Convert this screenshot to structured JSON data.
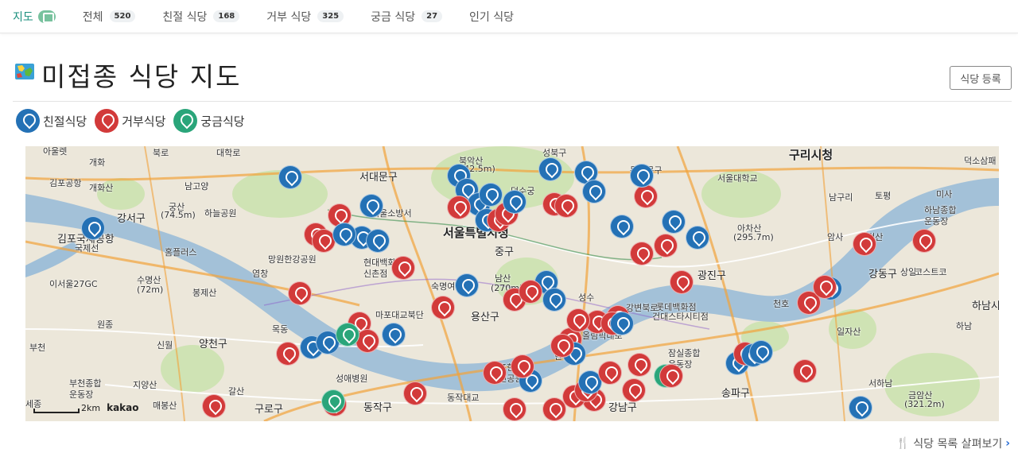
{
  "tabs": [
    {
      "label": "지도",
      "count": null,
      "active": true,
      "icon": "map-icon"
    },
    {
      "label": "전체",
      "count": "520"
    },
    {
      "label": "친절 식당",
      "count": "168"
    },
    {
      "label": "거부 식당",
      "count": "325"
    },
    {
      "label": "궁금 식당",
      "count": "27"
    },
    {
      "label": "인기 식당",
      "count": null
    }
  ],
  "page": {
    "title": "미접종 식당 지도",
    "title_icon": "world-map-icon",
    "register_label": "식당 등록"
  },
  "legend": [
    {
      "label": "친절식당",
      "color": "#2471b5"
    },
    {
      "label": "거부식당",
      "color": "#d23a3a"
    },
    {
      "label": "궁금식당",
      "color": "#2aa57a"
    }
  ],
  "map": {
    "labels": [
      {
        "text": "아울렛",
        "cls": ""
      },
      {
        "text": "개화",
        "cls": ""
      },
      {
        "text": "김포공항",
        "cls": ""
      },
      {
        "text": "개화산",
        "cls": ""
      },
      {
        "text": "강서구",
        "cls": "mid"
      },
      {
        "text": "궁산",
        "cls": ""
      },
      {
        "text": "(74.5m)",
        "cls": ""
      },
      {
        "text": "김포국제공항",
        "cls": "mid"
      },
      {
        "text": "국제선",
        "cls": ""
      },
      {
        "text": "홈플러스",
        "cls": ""
      },
      {
        "text": "이서울27GC",
        "cls": ""
      },
      {
        "text": "수명산",
        "cls": ""
      },
      {
        "text": "(72m)",
        "cls": ""
      },
      {
        "text": "봉제산",
        "cls": ""
      },
      {
        "text": "염창",
        "cls": ""
      },
      {
        "text": "망원한강공원",
        "cls": ""
      },
      {
        "text": "하늘공원",
        "cls": ""
      },
      {
        "text": "서대문구",
        "cls": "mid"
      },
      {
        "text": "서울소방서",
        "cls": ""
      },
      {
        "text": "현대백화점",
        "cls": ""
      },
      {
        "text": "신촌점",
        "cls": ""
      },
      {
        "text": "숙명여대",
        "cls": ""
      },
      {
        "text": "서울특별시청",
        "cls": "big"
      },
      {
        "text": "중구",
        "cls": "mid"
      },
      {
        "text": "남산",
        "cls": ""
      },
      {
        "text": "(270m)",
        "cls": ""
      },
      {
        "text": "용산구",
        "cls": "mid"
      },
      {
        "text": "마포대교북단",
        "cls": ""
      },
      {
        "text": "목동",
        "cls": ""
      },
      {
        "text": "양천구",
        "cls": "mid"
      },
      {
        "text": "신월",
        "cls": ""
      },
      {
        "text": "원종",
        "cls": ""
      },
      {
        "text": "부천",
        "cls": ""
      },
      {
        "text": "부천종합",
        "cls": ""
      },
      {
        "text": "운동장",
        "cls": ""
      },
      {
        "text": "지양산",
        "cls": ""
      },
      {
        "text": "매봉산",
        "cls": ""
      },
      {
        "text": "갈산",
        "cls": ""
      },
      {
        "text": "구로구",
        "cls": "mid"
      },
      {
        "text": "성애병원",
        "cls": ""
      },
      {
        "text": "동작구",
        "cls": "mid"
      },
      {
        "text": "동작대교",
        "cls": ""
      },
      {
        "text": "반포한강",
        "cls": ""
      },
      {
        "text": "시민공원",
        "cls": ""
      },
      {
        "text": "한남",
        "cls": ""
      },
      {
        "text": "성수",
        "cls": ""
      },
      {
        "text": "광진구",
        "cls": "mid"
      },
      {
        "text": "롯데백화점",
        "cls": ""
      },
      {
        "text": "건대스타시티점",
        "cls": ""
      },
      {
        "text": "강남구",
        "cls": "mid"
      },
      {
        "text": "잠실종합",
        "cls": ""
      },
      {
        "text": "운동장",
        "cls": ""
      },
      {
        "text": "송파구",
        "cls": "mid"
      },
      {
        "text": "석촌",
        "cls": ""
      },
      {
        "text": "천호",
        "cls": ""
      },
      {
        "text": "일자산",
        "cls": ""
      },
      {
        "text": "하남",
        "cls": ""
      },
      {
        "text": "강동구",
        "cls": "mid"
      },
      {
        "text": "상일",
        "cls": ""
      },
      {
        "text": "코스트코",
        "cls": ""
      },
      {
        "text": "하남시",
        "cls": "mid"
      },
      {
        "text": "아차산",
        "cls": ""
      },
      {
        "text": "(295.7m)",
        "cls": ""
      },
      {
        "text": "구리시청",
        "cls": "big"
      },
      {
        "text": "서울대학교",
        "cls": ""
      },
      {
        "text": "동대문구",
        "cls": ""
      },
      {
        "text": "북악산",
        "cls": ""
      },
      {
        "text": "(342.5m)",
        "cls": ""
      },
      {
        "text": "성북구",
        "cls": ""
      },
      {
        "text": "덕수궁",
        "cls": ""
      },
      {
        "text": "대학로",
        "cls": ""
      },
      {
        "text": "남고양",
        "cls": ""
      },
      {
        "text": "북로",
        "cls": ""
      },
      {
        "text": "토평",
        "cls": ""
      },
      {
        "text": "미사",
        "cls": ""
      },
      {
        "text": "하남종합",
        "cls": ""
      },
      {
        "text": "운동장",
        "cls": ""
      },
      {
        "text": "덕소삼패",
        "cls": ""
      },
      {
        "text": "남구리",
        "cls": ""
      },
      {
        "text": "고덕산",
        "cls": ""
      },
      {
        "text": "암사",
        "cls": ""
      },
      {
        "text": "서하남",
        "cls": ""
      },
      {
        "text": "금암산",
        "cls": ""
      },
      {
        "text": "(321.2m)",
        "cls": ""
      },
      {
        "text": "올림픽대로",
        "cls": ""
      },
      {
        "text": "강변북로",
        "cls": ""
      },
      {
        "text": "세종",
        "cls": ""
      }
    ],
    "markers": [
      {
        "color": "#2471b5"
      },
      {
        "color": "#2471b5"
      },
      {
        "color": "#d23a3a"
      },
      {
        "color": "#2471b5"
      },
      {
        "color": "#d23a3a"
      },
      {
        "color": "#2471b5"
      },
      {
        "color": "#d23a3a"
      },
      {
        "color": "#2471b5"
      },
      {
        "color": "#2471b5"
      },
      {
        "color": "#d23a3a"
      },
      {
        "color": "#2471b5"
      },
      {
        "color": "#2471b5"
      },
      {
        "color": "#2471b5"
      },
      {
        "color": "#2471b5"
      },
      {
        "color": "#d23a3a"
      },
      {
        "color": "#2471b5"
      },
      {
        "color": "#2471b5"
      },
      {
        "color": "#d23a3a"
      },
      {
        "color": "#d23a3a"
      },
      {
        "color": "#2471b5"
      },
      {
        "color": "#d23a3a"
      },
      {
        "color": "#2471b5"
      },
      {
        "color": "#2471b5"
      },
      {
        "color": "#d23a3a"
      },
      {
        "color": "#2471b5"
      },
      {
        "color": "#d23a3a"
      },
      {
        "color": "#2471b5"
      },
      {
        "color": "#2471b5"
      },
      {
        "color": "#d23a3a"
      },
      {
        "color": "#d23a3a"
      },
      {
        "color": "#2471b5"
      },
      {
        "color": "#d23a3a"
      },
      {
        "color": "#2471b5"
      },
      {
        "color": "#d23a3a"
      },
      {
        "color": "#d23a3a"
      },
      {
        "color": "#2471b5"
      },
      {
        "color": "#d23a3a"
      },
      {
        "color": "#d23a3a"
      },
      {
        "color": "#2471b5"
      },
      {
        "color": "#d23a3a"
      },
      {
        "color": "#2471b5"
      },
      {
        "color": "#d23a3a"
      },
      {
        "color": "#d23a3a"
      },
      {
        "color": "#2471b5"
      },
      {
        "color": "#d23a3a"
      },
      {
        "color": "#d23a3a"
      },
      {
        "color": "#d23a3a"
      },
      {
        "color": "#2471b5"
      },
      {
        "color": "#d23a3a"
      },
      {
        "color": "#d23a3a"
      },
      {
        "color": "#d23a3a"
      },
      {
        "color": "#2aa57a"
      },
      {
        "color": "#d23a3a"
      },
      {
        "color": "#2471b5"
      },
      {
        "color": "#d23a3a"
      },
      {
        "color": "#d23a3a"
      },
      {
        "color": "#d23a3a"
      },
      {
        "color": "#2aa57a"
      },
      {
        "color": "#d23a3a"
      },
      {
        "color": "#d23a3a"
      },
      {
        "color": "#d23a3a"
      },
      {
        "color": "#2471b5"
      },
      {
        "color": "#d23a3a"
      },
      {
        "color": "#d23a3a"
      },
      {
        "color": "#d23a3a"
      },
      {
        "color": "#2471b5"
      },
      {
        "color": "#d23a3a"
      },
      {
        "color": "#2471b5"
      },
      {
        "color": "#d23a3a"
      },
      {
        "color": "#2471b5"
      },
      {
        "color": "#2471b5"
      },
      {
        "color": "#d23a3a"
      },
      {
        "color": "#2471b5"
      },
      {
        "color": "#d23a3a"
      },
      {
        "color": "#d23a3a"
      },
      {
        "color": "#2471b5"
      },
      {
        "color": "#d23a3a"
      },
      {
        "color": "#d23a3a"
      },
      {
        "color": "#d23a3a"
      },
      {
        "color": "#d23a3a"
      },
      {
        "color": "#2471b5"
      },
      {
        "color": "#2aa57a"
      },
      {
        "color": "#d23a3a"
      }
    ],
    "scale_label": "2km",
    "provider": "kakao"
  },
  "footer": {
    "list_link": "식당 목록 살펴보기",
    "fork_icon": "utensils-icon",
    "chevron_icon": "chevron-right-icon"
  }
}
